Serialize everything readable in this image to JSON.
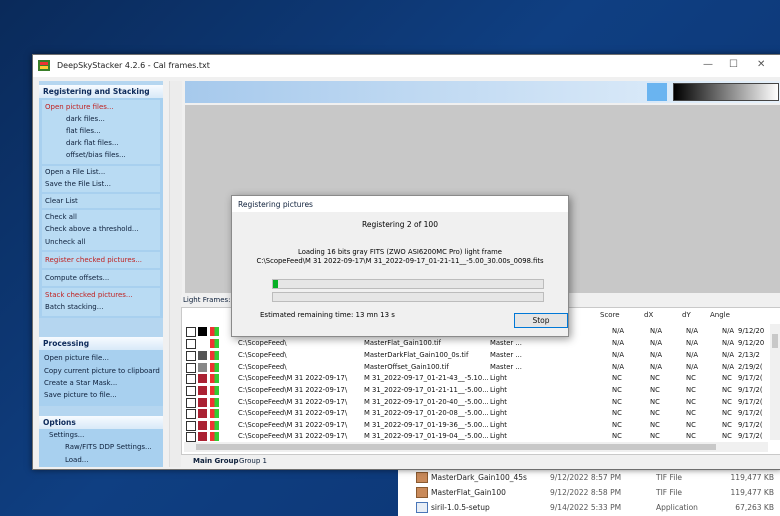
{
  "window": {
    "title": "DeepSkyStacker 4.2.6 - Cal frames.txt",
    "controls": {
      "minimize": "—",
      "maximize": "☐",
      "close": "✕"
    }
  },
  "panel": {
    "registering": {
      "title": "Registering and Stacking",
      "open_files": "Open picture files...",
      "dark_files": "dark files...",
      "flat_files": "flat files...",
      "dark_flat_files": "dark flat files...",
      "offset_files": "offset/bias files...",
      "open_list": "Open a File List...",
      "save_list": "Save the File List...",
      "clear_list": "Clear List",
      "check_all": "Check all",
      "check_above": "Check above a threshold...",
      "uncheck_all": "Uncheck all",
      "register_checked": "Register checked pictures...",
      "compute_offsets": "Compute offsets...",
      "stack_checked": "Stack checked pictures...",
      "batch_stacking": "Batch stacking..."
    },
    "processing": {
      "title": "Processing",
      "open_picture": "Open picture file...",
      "copy_clipboard": "Copy current picture to clipboard",
      "star_mask": "Create a Star Mask...",
      "save_picture": "Save picture to file..."
    },
    "options": {
      "title": "Options",
      "settings": "Settings...",
      "raw_settings": "Raw/FITS DDP Settings...",
      "load": "Load..."
    }
  },
  "list": {
    "label": "Light Frames: 100",
    "columns": {
      "path": "P",
      "score": "Score",
      "dx": "dX",
      "dy": "dY",
      "angle": "Angle"
    },
    "rows": [
      {
        "path": "C:\\ScopeFeed\\",
        "file": "MasterFlat_Gain100.tif",
        "type": "Master ...",
        "score": "N/A",
        "dx": "N/A",
        "dy": "N/A",
        "angle": "N/A",
        "date": "9/12/20"
      },
      {
        "path": "C:\\ScopeFeed\\",
        "file": "MasterDarkFlat_Gain100_0s.tif",
        "type": "Master ...",
        "score": "N/A",
        "dx": "N/A",
        "dy": "N/A",
        "angle": "N/A",
        "date": "2/13/2"
      },
      {
        "path": "C:\\ScopeFeed\\",
        "file": "MasterOffset_Gain100.tif",
        "type": "Master ...",
        "score": "N/A",
        "dx": "N/A",
        "dy": "N/A",
        "angle": "N/A",
        "date": "2/19/2("
      },
      {
        "path": "C:\\ScopeFeed\\M 31 2022-09-17\\",
        "file": "M 31_2022-09-17_01-21-43__-5.10...",
        "type": "Light",
        "score": "NC",
        "dx": "NC",
        "dy": "NC",
        "angle": "NC",
        "date": "9/17/2("
      },
      {
        "path": "C:\\ScopeFeed\\M 31 2022-09-17\\",
        "file": "M 31_2022-09-17_01-21-11__-5.00...",
        "type": "Light",
        "score": "NC",
        "dx": "NC",
        "dy": "NC",
        "angle": "NC",
        "date": "9/17/2("
      },
      {
        "path": "C:\\ScopeFeed\\M 31 2022-09-17\\",
        "file": "M 31_2022-09-17_01-20-40__-5.00...",
        "type": "Light",
        "score": "NC",
        "dx": "NC",
        "dy": "NC",
        "angle": "NC",
        "date": "9/17/2("
      },
      {
        "path": "C:\\ScopeFeed\\M 31 2022-09-17\\",
        "file": "M 31_2022-09-17_01-20-08__-5.00...",
        "type": "Light",
        "score": "NC",
        "dx": "NC",
        "dy": "NC",
        "angle": "NC",
        "date": "9/17/2("
      },
      {
        "path": "C:\\ScopeFeed\\M 31 2022-09-17\\",
        "file": "M 31_2022-09-17_01-19-36__-5.00...",
        "type": "Light",
        "score": "NC",
        "dx": "NC",
        "dy": "NC",
        "angle": "NC",
        "date": "9/17/2("
      },
      {
        "path": "C:\\ScopeFeed\\M 31 2022-09-17\\",
        "file": "M 31_2022-09-17_01-19-04__-5.00...",
        "type": "Light",
        "score": "NC",
        "dx": "NC",
        "dy": "NC",
        "angle": "NC",
        "date": "9/17/2("
      }
    ],
    "first_row_partial": {
      "score": "N/A",
      "dx": "N/A",
      "dy": "N/A",
      "angle": "N/A",
      "date": "9/12/20"
    },
    "tabs": {
      "main": "Main Group",
      "group1": "Group 1"
    }
  },
  "dialog": {
    "title": "Registering pictures",
    "status": "Registering 2 of 100",
    "line1": "Loading 16 bits gray FITS (ZWO ASI6200MC Pro) light frame",
    "line2": "C:\\ScopeFeed\\M 31 2022-09-17\\M 31_2022-09-17_01-21-11__-5.00_30.00s_0098.fits",
    "eta": "Estimated remaining time: 13 mn 13 s",
    "stop": "Stop",
    "progress1": 0.02,
    "progress2": 0.0
  },
  "explorer": {
    "files": [
      {
        "name": "MasterDark_Gain100_45s",
        "date": "9/12/2022 8:57 PM",
        "type": "TIF File",
        "size": "119,477 KB"
      },
      {
        "name": "MasterFlat_Gain100",
        "date": "9/12/2022 8:58 PM",
        "type": "TIF File",
        "size": "119,477 KB"
      },
      {
        "name": "siril-1.0.5-setup",
        "date": "9/14/2022 5:33 PM",
        "type": "Application",
        "size": "67,263 KB"
      }
    ]
  }
}
